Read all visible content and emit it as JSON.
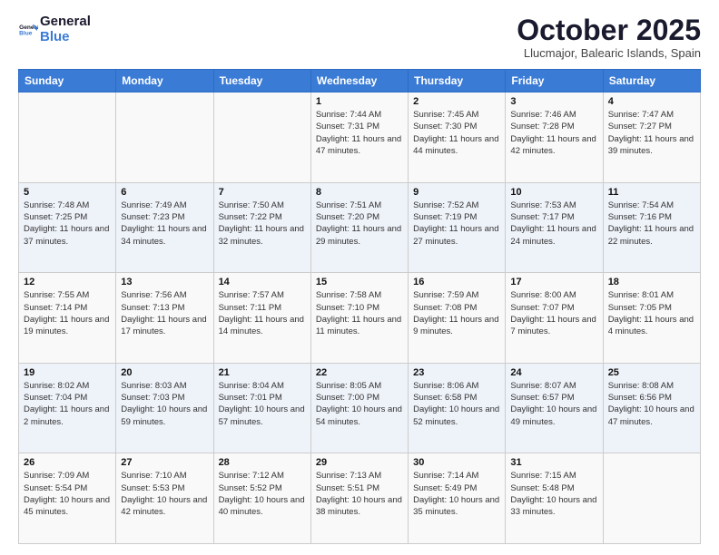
{
  "header": {
    "logo_general": "General",
    "logo_blue": "Blue",
    "month_title": "October 2025",
    "location": "Llucmajor, Balearic Islands, Spain"
  },
  "weekdays": [
    "Sunday",
    "Monday",
    "Tuesday",
    "Wednesday",
    "Thursday",
    "Friday",
    "Saturday"
  ],
  "weeks": [
    [
      {
        "day": "",
        "sunrise": "",
        "sunset": "",
        "daylight": ""
      },
      {
        "day": "",
        "sunrise": "",
        "sunset": "",
        "daylight": ""
      },
      {
        "day": "",
        "sunrise": "",
        "sunset": "",
        "daylight": ""
      },
      {
        "day": "1",
        "sunrise": "Sunrise: 7:44 AM",
        "sunset": "Sunset: 7:31 PM",
        "daylight": "Daylight: 11 hours and 47 minutes."
      },
      {
        "day": "2",
        "sunrise": "Sunrise: 7:45 AM",
        "sunset": "Sunset: 7:30 PM",
        "daylight": "Daylight: 11 hours and 44 minutes."
      },
      {
        "day": "3",
        "sunrise": "Sunrise: 7:46 AM",
        "sunset": "Sunset: 7:28 PM",
        "daylight": "Daylight: 11 hours and 42 minutes."
      },
      {
        "day": "4",
        "sunrise": "Sunrise: 7:47 AM",
        "sunset": "Sunset: 7:27 PM",
        "daylight": "Daylight: 11 hours and 39 minutes."
      }
    ],
    [
      {
        "day": "5",
        "sunrise": "Sunrise: 7:48 AM",
        "sunset": "Sunset: 7:25 PM",
        "daylight": "Daylight: 11 hours and 37 minutes."
      },
      {
        "day": "6",
        "sunrise": "Sunrise: 7:49 AM",
        "sunset": "Sunset: 7:23 PM",
        "daylight": "Daylight: 11 hours and 34 minutes."
      },
      {
        "day": "7",
        "sunrise": "Sunrise: 7:50 AM",
        "sunset": "Sunset: 7:22 PM",
        "daylight": "Daylight: 11 hours and 32 minutes."
      },
      {
        "day": "8",
        "sunrise": "Sunrise: 7:51 AM",
        "sunset": "Sunset: 7:20 PM",
        "daylight": "Daylight: 11 hours and 29 minutes."
      },
      {
        "day": "9",
        "sunrise": "Sunrise: 7:52 AM",
        "sunset": "Sunset: 7:19 PM",
        "daylight": "Daylight: 11 hours and 27 minutes."
      },
      {
        "day": "10",
        "sunrise": "Sunrise: 7:53 AM",
        "sunset": "Sunset: 7:17 PM",
        "daylight": "Daylight: 11 hours and 24 minutes."
      },
      {
        "day": "11",
        "sunrise": "Sunrise: 7:54 AM",
        "sunset": "Sunset: 7:16 PM",
        "daylight": "Daylight: 11 hours and 22 minutes."
      }
    ],
    [
      {
        "day": "12",
        "sunrise": "Sunrise: 7:55 AM",
        "sunset": "Sunset: 7:14 PM",
        "daylight": "Daylight: 11 hours and 19 minutes."
      },
      {
        "day": "13",
        "sunrise": "Sunrise: 7:56 AM",
        "sunset": "Sunset: 7:13 PM",
        "daylight": "Daylight: 11 hours and 17 minutes."
      },
      {
        "day": "14",
        "sunrise": "Sunrise: 7:57 AM",
        "sunset": "Sunset: 7:11 PM",
        "daylight": "Daylight: 11 hours and 14 minutes."
      },
      {
        "day": "15",
        "sunrise": "Sunrise: 7:58 AM",
        "sunset": "Sunset: 7:10 PM",
        "daylight": "Daylight: 11 hours and 11 minutes."
      },
      {
        "day": "16",
        "sunrise": "Sunrise: 7:59 AM",
        "sunset": "Sunset: 7:08 PM",
        "daylight": "Daylight: 11 hours and 9 minutes."
      },
      {
        "day": "17",
        "sunrise": "Sunrise: 8:00 AM",
        "sunset": "Sunset: 7:07 PM",
        "daylight": "Daylight: 11 hours and 7 minutes."
      },
      {
        "day": "18",
        "sunrise": "Sunrise: 8:01 AM",
        "sunset": "Sunset: 7:05 PM",
        "daylight": "Daylight: 11 hours and 4 minutes."
      }
    ],
    [
      {
        "day": "19",
        "sunrise": "Sunrise: 8:02 AM",
        "sunset": "Sunset: 7:04 PM",
        "daylight": "Daylight: 11 hours and 2 minutes."
      },
      {
        "day": "20",
        "sunrise": "Sunrise: 8:03 AM",
        "sunset": "Sunset: 7:03 PM",
        "daylight": "Daylight: 10 hours and 59 minutes."
      },
      {
        "day": "21",
        "sunrise": "Sunrise: 8:04 AM",
        "sunset": "Sunset: 7:01 PM",
        "daylight": "Daylight: 10 hours and 57 minutes."
      },
      {
        "day": "22",
        "sunrise": "Sunrise: 8:05 AM",
        "sunset": "Sunset: 7:00 PM",
        "daylight": "Daylight: 10 hours and 54 minutes."
      },
      {
        "day": "23",
        "sunrise": "Sunrise: 8:06 AM",
        "sunset": "Sunset: 6:58 PM",
        "daylight": "Daylight: 10 hours and 52 minutes."
      },
      {
        "day": "24",
        "sunrise": "Sunrise: 8:07 AM",
        "sunset": "Sunset: 6:57 PM",
        "daylight": "Daylight: 10 hours and 49 minutes."
      },
      {
        "day": "25",
        "sunrise": "Sunrise: 8:08 AM",
        "sunset": "Sunset: 6:56 PM",
        "daylight": "Daylight: 10 hours and 47 minutes."
      }
    ],
    [
      {
        "day": "26",
        "sunrise": "Sunrise: 7:09 AM",
        "sunset": "Sunset: 5:54 PM",
        "daylight": "Daylight: 10 hours and 45 minutes."
      },
      {
        "day": "27",
        "sunrise": "Sunrise: 7:10 AM",
        "sunset": "Sunset: 5:53 PM",
        "daylight": "Daylight: 10 hours and 42 minutes."
      },
      {
        "day": "28",
        "sunrise": "Sunrise: 7:12 AM",
        "sunset": "Sunset: 5:52 PM",
        "daylight": "Daylight: 10 hours and 40 minutes."
      },
      {
        "day": "29",
        "sunrise": "Sunrise: 7:13 AM",
        "sunset": "Sunset: 5:51 PM",
        "daylight": "Daylight: 10 hours and 38 minutes."
      },
      {
        "day": "30",
        "sunrise": "Sunrise: 7:14 AM",
        "sunset": "Sunset: 5:49 PM",
        "daylight": "Daylight: 10 hours and 35 minutes."
      },
      {
        "day": "31",
        "sunrise": "Sunrise: 7:15 AM",
        "sunset": "Sunset: 5:48 PM",
        "daylight": "Daylight: 10 hours and 33 minutes."
      },
      {
        "day": "",
        "sunrise": "",
        "sunset": "",
        "daylight": ""
      }
    ]
  ]
}
